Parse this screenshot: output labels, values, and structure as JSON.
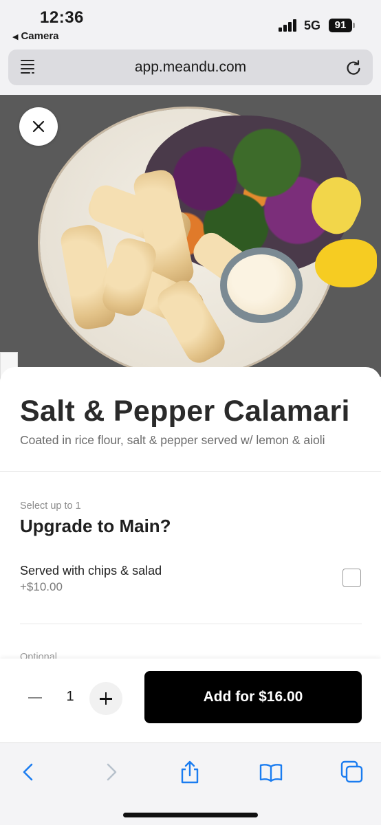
{
  "status_bar": {
    "time": "12:36",
    "back_app": "Camera",
    "network": "5G",
    "battery": "91"
  },
  "browser": {
    "url": "app.meandu.com"
  },
  "item": {
    "title": "Salt & Pepper Calamari",
    "description": "Coated in rice flour, salt & pepper served w/ lemon & aioli"
  },
  "modifier_group": {
    "hint": "Select up to 1",
    "title": "Upgrade to Main?",
    "options": [
      {
        "label": "Served with chips & salad",
        "price": "+$10.00",
        "selected": false
      }
    ]
  },
  "next_group": {
    "hint": "Optional"
  },
  "action_bar": {
    "quantity": "1",
    "add_label": "Add for $16.00"
  },
  "colors": {
    "accent": "#000000",
    "safari_blue": "#1a7cf0",
    "sheet_bg": "#ffffff"
  },
  "icons": {
    "close": "close-icon",
    "reader": "reader-mode-icon",
    "reload": "reload-icon",
    "back": "back-icon",
    "forward": "forward-icon",
    "share": "share-icon",
    "bookmarks": "bookmarks-icon",
    "tabs": "tabs-icon"
  }
}
